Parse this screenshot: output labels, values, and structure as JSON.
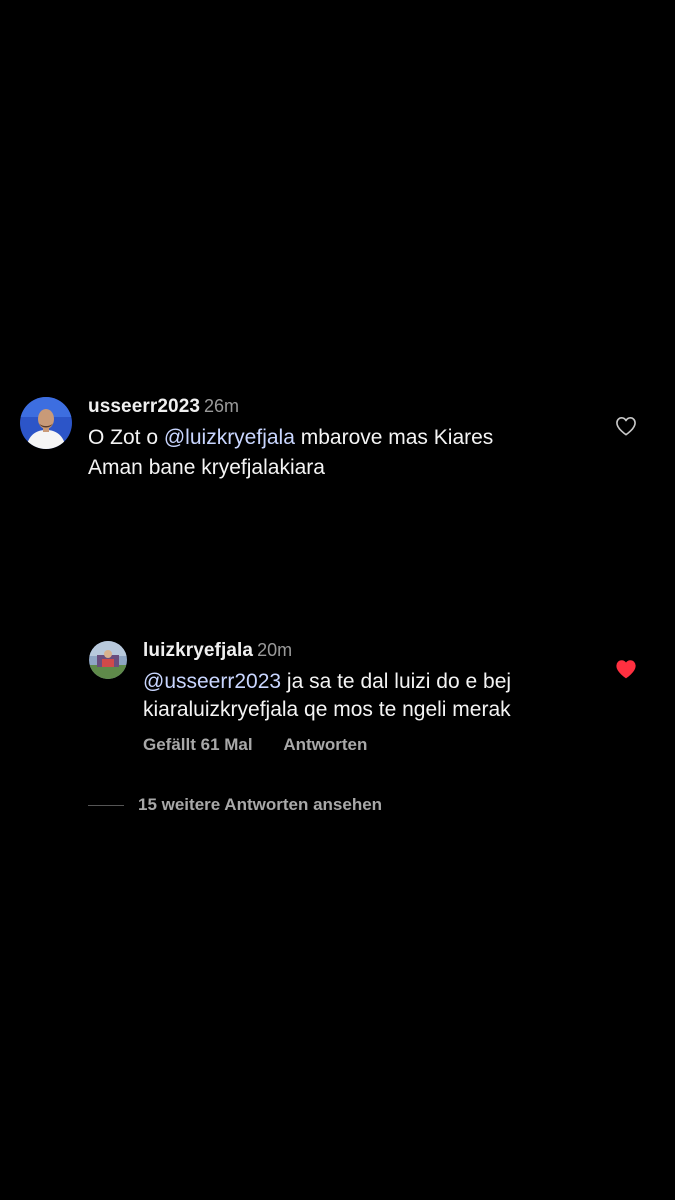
{
  "comment": {
    "username": "usseerr2023",
    "time": "26m",
    "line1_prefix": "O Zot o ",
    "line1_mention": "@luizkryefjala",
    "line1_suffix": " mbarove mas Kiares",
    "line2": "Aman bane kryefjalakiara",
    "liked": false
  },
  "reply": {
    "username": "luizkryefjala",
    "time": "20m",
    "line1_mention": "@usseerr2023",
    "line1_suffix": " ja sa te dal luizi do e bej",
    "line2": "kiaraluizkryefjala qe mos te ngeli merak",
    "likes_label": "Gefällt 61 Mal",
    "reply_label": "Antworten",
    "liked": true
  },
  "view_more_replies": "15 weitere Antworten ansehen",
  "colors": {
    "background": "#000000",
    "like_active": "#ff3040",
    "muted_text": "#a8a8a8"
  }
}
